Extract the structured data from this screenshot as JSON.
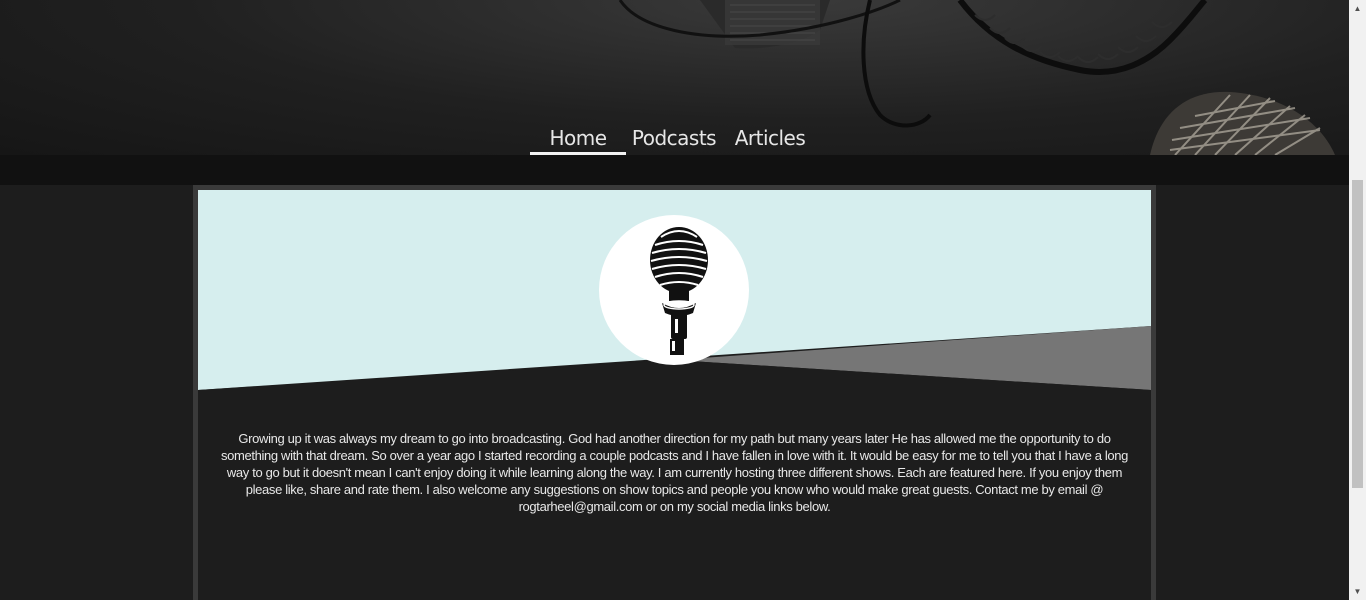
{
  "nav": {
    "items": [
      {
        "label": "Home",
        "active": true
      },
      {
        "label": "Podcasts",
        "active": false
      },
      {
        "label": "Articles",
        "active": false
      }
    ]
  },
  "hero": {
    "image": "dark-microphone-headphones-photo"
  },
  "card": {
    "logo_icon": "microphone-icon",
    "bio": "Growing up it was always my dream to go into broadcasting. God had another direction for my path but many years later He has allowed me the opportunity to do something with that dream. So over a year ago I started recording a couple podcasts and I have fallen in love with it. It would be easy for me to tell you that I have a long way to go but it doesn't mean I can't enjoy doing it while learning along the way. I am currently hosting three different shows. Each are featured here. If you enjoy them please like, share and rate them. I also welcome any suggestions on show topics and people you know who would make great guests. Contact me by email @ rogtarheel@gmail.com or on my social media links below."
  },
  "colors": {
    "header_bg": "#1b1b1b",
    "band": "#111111",
    "card_top": "#d6eeee",
    "card_slant": "#767676",
    "body_bg": "#1d1d1d",
    "text": "#e8e8e8"
  }
}
